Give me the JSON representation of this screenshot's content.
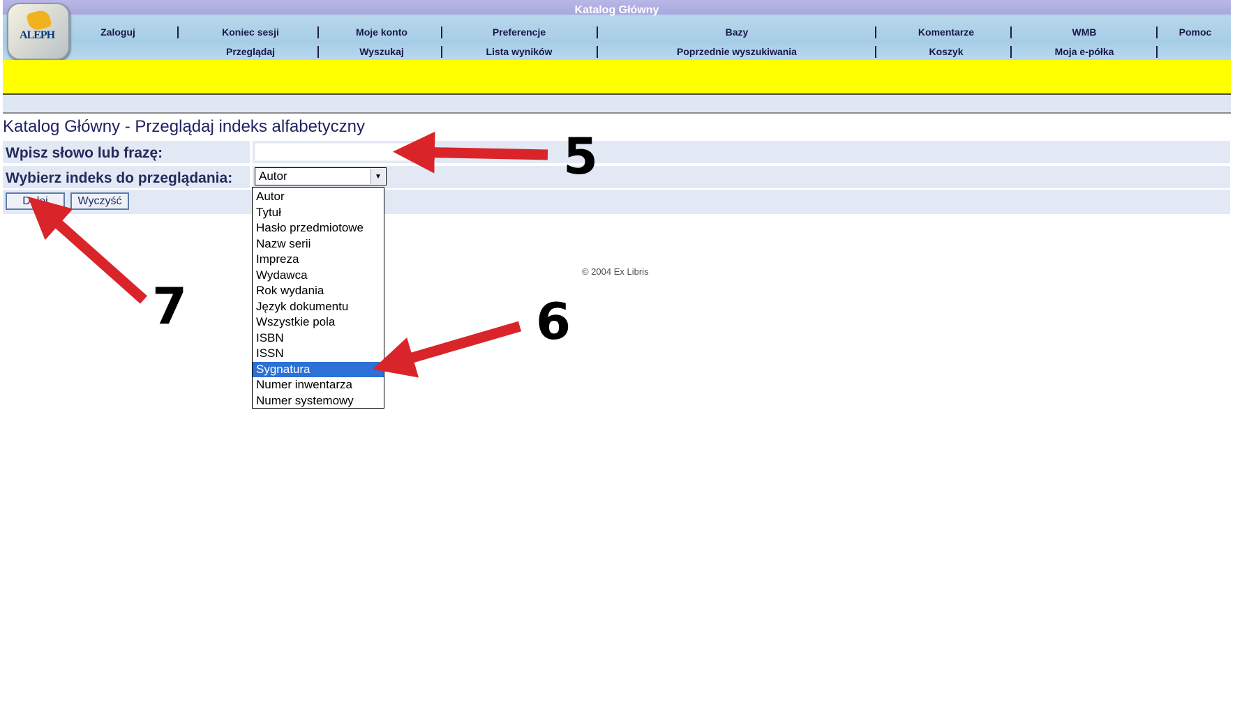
{
  "header": {
    "title": "Katalog Główny",
    "logo_text": "ALEPH",
    "nav_row1": [
      "Zaloguj",
      "Koniec sesji",
      "Moje konto",
      "Preferencje",
      "Bazy",
      "Komentarze",
      "WMB",
      "Pomoc"
    ],
    "nav_row2": [
      "Przeglądaj",
      "Wyszukaj",
      "Lista wyników",
      "Poprzednie wyszukiwania",
      "Koszyk",
      "Moja e-półka"
    ]
  },
  "page": {
    "title": "Katalog Główny - Przeglądaj indeks alfabetyczny"
  },
  "form": {
    "word_label": "Wpisz słowo lub frazę:",
    "word_value": "",
    "index_label": "Wybierz indeks do przeglądania:",
    "index_selected": "Autor",
    "index_options": [
      "Autor",
      "Tytuł",
      "Hasło przedmiotowe",
      "Nazw serii",
      "Impreza",
      "Wydawca",
      "Rok wydania",
      "Język dokumentu",
      "Wszystkie pola",
      "ISBN",
      "ISSN",
      "Sygnatura",
      "Numer inwentarza",
      "Numer systemowy"
    ],
    "highlighted_option": "Sygnatura",
    "submit_label": "Dalej",
    "clear_label": "Wyczyść"
  },
  "footer": {
    "copyright": "© 2004 Ex Libris"
  },
  "annotations": {
    "color": "#d9252a",
    "step_input": "5",
    "step_dropdown": "6",
    "step_button": "7"
  }
}
